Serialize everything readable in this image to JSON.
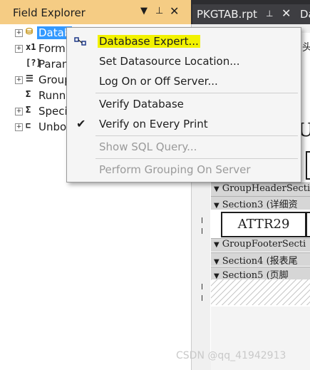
{
  "field_explorer": {
    "title": "Field Explorer",
    "header_icons": [
      "chevron-down-icon",
      "pin-icon",
      "close-icon"
    ],
    "items": [
      {
        "label": "Datab",
        "icon": "database-icon",
        "selected": true
      },
      {
        "label": "Form",
        "icon": "formula-icon"
      },
      {
        "label": "Param",
        "icon": "parameter-icon"
      },
      {
        "label": "Group",
        "icon": "group-icon"
      },
      {
        "label": "Runni",
        "icon": "running-total-icon"
      },
      {
        "label": "Speci",
        "icon": "special-field-icon"
      },
      {
        "label": "Unbo",
        "icon": "unbound-field-icon"
      }
    ]
  },
  "tabs": {
    "active": "PKGTAB.rpt",
    "next": "Da"
  },
  "report": {
    "top_glyph_1": "头",
    "top_glyph_2": "U",
    "sections": [
      "GroupHeaderSecti",
      "Section3 (详细资",
      "GroupFooterSecti",
      "Section4 (报表尾",
      "Section5 (页脚"
    ],
    "field_box": "ATTR29"
  },
  "context_menu": {
    "items": [
      {
        "label": "Database Expert...",
        "highlight": true,
        "icon": "database-expert-icon"
      },
      {
        "label": "Set Datasource Location..."
      },
      {
        "label": "Log On or Off Server..."
      },
      {
        "label": "Verify Database"
      },
      {
        "label": "Verify on Every Print",
        "checked": true
      },
      {
        "label": "Show SQL Query...",
        "disabled": true
      },
      {
        "label": "Perform Grouping On Server",
        "disabled": true
      }
    ]
  },
  "watermark": "CSDN @qq_41942913",
  "colors": {
    "panel_header": "#f5cc84",
    "selection": "#3399ff",
    "menu_highlight": "#f2f200",
    "dark_bg": "#2d2d30"
  }
}
